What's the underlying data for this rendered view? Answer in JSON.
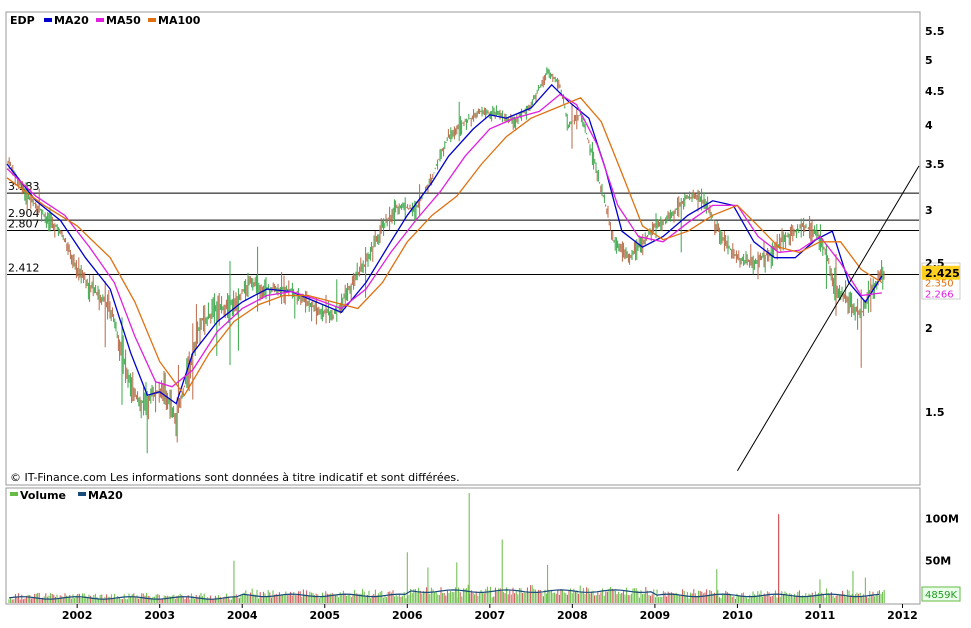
{
  "chart_data": [
    {
      "type": "line",
      "ticker": "EDP",
      "legend": [
        {
          "name": "EDP",
          "color": "#1a1a1a"
        },
        {
          "name": "MA20",
          "color": "#0000cc"
        },
        {
          "name": "MA50",
          "color": "#e020e0"
        },
        {
          "name": "MA100",
          "color": "#e07010"
        }
      ],
      "xlim": [
        2001.15,
        2012.2
      ],
      "ylim": [
        1.2,
        5.7
      ],
      "x_ticks": [
        "2002",
        "2003",
        "2004",
        "2005",
        "2006",
        "2007",
        "2008",
        "2009",
        "2010",
        "2011",
        "2012"
      ],
      "y_ticks": [
        "5.5",
        "5",
        "4.5",
        "4",
        "3.5",
        "3",
        "2.5",
        "2",
        "1.5"
      ],
      "grid": false,
      "legend_position": "top-left",
      "copyright": "© IT-Finance.com Les informations sont données à titre indicatif et sont différées.",
      "levels": [
        {
          "label": "3.183",
          "value": 3.183
        },
        {
          "label": "2.904",
          "value": 2.904
        },
        {
          "label": "2.807",
          "value": 2.807
        },
        {
          "label": "2.412",
          "value": 2.412
        }
      ],
      "trendline": {
        "x": [
          2010.0,
          2012.2
        ],
        "y": [
          1.15,
          3.48
        ]
      },
      "last_value": {
        "label": "2.425",
        "value": 2.425,
        "color": "#ffd020"
      },
      "side_values": [
        {
          "label": "2.350",
          "value": 2.35,
          "color": "#e07010"
        },
        {
          "label": "2.266",
          "value": 2.266,
          "color": "#e020e0"
        }
      ],
      "price": {
        "x": [
          2001.15,
          2001.4,
          2001.6,
          2001.8,
          2002.0,
          2002.2,
          2002.4,
          2002.6,
          2002.75,
          2002.9,
          2003.05,
          2003.2,
          2003.35,
          2003.5,
          2003.7,
          2003.9,
          2004.1,
          2004.3,
          2004.5,
          2004.7,
          2004.9,
          2005.1,
          2005.3,
          2005.5,
          2005.7,
          2005.9,
          2006.1,
          2006.3,
          2006.5,
          2006.7,
          2006.9,
          2007.1,
          2007.3,
          2007.5,
          2007.7,
          2007.85,
          2007.95,
          2008.1,
          2008.3,
          2008.5,
          2008.7,
          2008.85,
          2009.0,
          2009.2,
          2009.4,
          2009.6,
          2009.8,
          2010.0,
          2010.2,
          2010.4,
          2010.6,
          2010.8,
          2011.0,
          2011.2,
          2011.35,
          2011.5,
          2011.6,
          2011.75
        ],
        "y": [
          3.55,
          3.15,
          2.95,
          2.8,
          2.45,
          2.3,
          2.15,
          1.75,
          1.55,
          1.6,
          1.65,
          1.45,
          1.75,
          2.05,
          2.15,
          2.2,
          2.35,
          2.3,
          2.3,
          2.25,
          2.15,
          2.1,
          2.3,
          2.5,
          2.85,
          3.05,
          3.0,
          3.35,
          3.85,
          4.05,
          4.2,
          4.15,
          4.05,
          4.3,
          4.8,
          4.6,
          4.0,
          4.15,
          3.4,
          2.7,
          2.55,
          2.7,
          2.85,
          2.95,
          3.15,
          3.1,
          2.75,
          2.55,
          2.5,
          2.6,
          2.75,
          2.85,
          2.75,
          2.3,
          2.2,
          2.1,
          2.25,
          2.42
        ]
      },
      "series": [
        {
          "name": "MA20",
          "color": "#0000cc",
          "x": [
            2001.15,
            2001.5,
            2001.8,
            2002.1,
            2002.4,
            2002.65,
            2002.85,
            2003.0,
            2003.2,
            2003.4,
            2003.7,
            2004.0,
            2004.3,
            2004.6,
            2004.9,
            2005.2,
            2005.5,
            2005.8,
            2006.0,
            2006.3,
            2006.5,
            2006.8,
            2007.0,
            2007.2,
            2007.5,
            2007.75,
            2007.95,
            2008.2,
            2008.4,
            2008.6,
            2008.85,
            2009.1,
            2009.4,
            2009.7,
            2009.95,
            2010.2,
            2010.45,
            2010.7,
            2010.95,
            2011.15,
            2011.35,
            2011.55,
            2011.75
          ],
          "y": [
            3.5,
            3.1,
            2.9,
            2.55,
            2.3,
            1.85,
            1.6,
            1.62,
            1.55,
            1.85,
            2.05,
            2.2,
            2.3,
            2.28,
            2.2,
            2.12,
            2.35,
            2.7,
            2.95,
            3.3,
            3.6,
            3.95,
            4.15,
            4.1,
            4.25,
            4.6,
            4.35,
            4.1,
            3.45,
            2.8,
            2.65,
            2.75,
            2.95,
            3.1,
            3.05,
            2.7,
            2.55,
            2.55,
            2.72,
            2.8,
            2.35,
            2.2,
            2.4
          ]
        },
        {
          "name": "MA50",
          "color": "#e020e0",
          "x": [
            2001.15,
            2001.5,
            2001.85,
            2002.15,
            2002.45,
            2002.7,
            2002.95,
            2003.15,
            2003.4,
            2003.7,
            2004.0,
            2004.3,
            2004.6,
            2004.9,
            2005.2,
            2005.5,
            2005.8,
            2006.1,
            2006.4,
            2006.7,
            2007.0,
            2007.3,
            2007.6,
            2007.85,
            2008.05,
            2008.3,
            2008.55,
            2008.8,
            2009.1,
            2009.4,
            2009.7,
            2010.0,
            2010.25,
            2010.5,
            2010.75,
            2011.0,
            2011.25,
            2011.5,
            2011.75
          ],
          "y": [
            3.45,
            3.15,
            2.95,
            2.65,
            2.35,
            1.95,
            1.68,
            1.65,
            1.75,
            1.98,
            2.15,
            2.25,
            2.28,
            2.22,
            2.15,
            2.3,
            2.6,
            2.9,
            3.2,
            3.6,
            3.95,
            4.1,
            4.2,
            4.45,
            4.3,
            3.75,
            3.05,
            2.75,
            2.7,
            2.88,
            3.05,
            3.05,
            2.75,
            2.6,
            2.62,
            2.75,
            2.5,
            2.25,
            2.27
          ]
        },
        {
          "name": "MA100",
          "color": "#e07010",
          "x": [
            2001.15,
            2001.6,
            2002.0,
            2002.4,
            2002.7,
            2003.0,
            2003.3,
            2003.6,
            2003.9,
            2004.2,
            2004.5,
            2004.8,
            2005.1,
            2005.4,
            2005.7,
            2006.0,
            2006.3,
            2006.6,
            2006.9,
            2007.2,
            2007.5,
            2007.8,
            2008.1,
            2008.35,
            2008.6,
            2008.85,
            2009.1,
            2009.4,
            2009.7,
            2010.0,
            2010.25,
            2010.5,
            2010.75,
            2011.0,
            2011.25,
            2011.5,
            2011.75
          ],
          "y": [
            3.35,
            3.05,
            2.85,
            2.55,
            2.2,
            1.8,
            1.6,
            1.85,
            2.05,
            2.18,
            2.25,
            2.25,
            2.2,
            2.15,
            2.35,
            2.7,
            2.95,
            3.15,
            3.5,
            3.85,
            4.1,
            4.25,
            4.4,
            4.05,
            3.4,
            2.85,
            2.72,
            2.8,
            2.95,
            3.05,
            2.85,
            2.65,
            2.6,
            2.7,
            2.7,
            2.45,
            2.35
          ]
        }
      ]
    },
    {
      "type": "bar",
      "legend": [
        {
          "name": "Volume",
          "color": "#66bb44"
        },
        {
          "name": "MA20",
          "color": "#1a4a7a"
        }
      ],
      "ylim": [
        0,
        130
      ],
      "y_ticks": [
        "100M",
        "50M"
      ],
      "last_value": {
        "label": "4859K"
      },
      "spikes": {
        "x": [
          2003.9,
          2006.0,
          2006.25,
          2006.6,
          2006.75,
          2007.15,
          2007.7,
          2009.75,
          2010.5,
          2011.0,
          2011.4,
          2011.55
        ],
        "y": [
          50,
          60,
          42,
          48,
          130,
          75,
          45,
          40,
          105,
          28,
          38,
          30
        ]
      }
    }
  ]
}
